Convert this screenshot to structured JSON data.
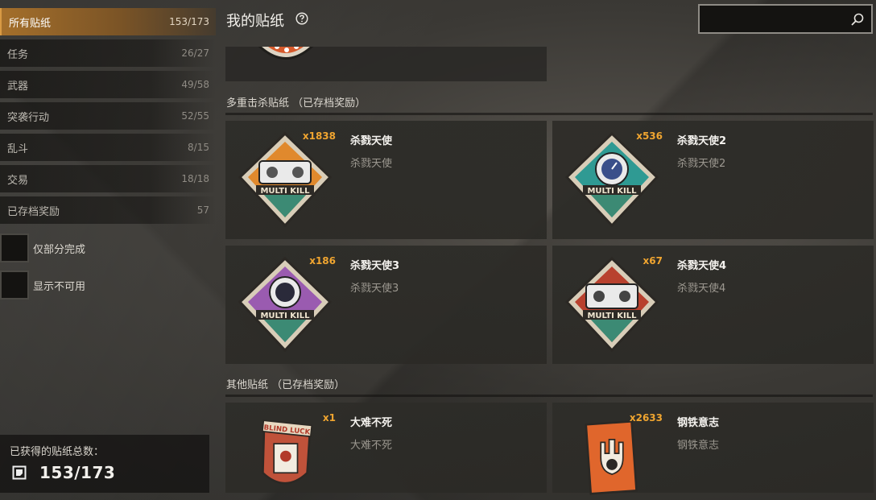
{
  "sidebar": {
    "categories": [
      {
        "label": "所有贴纸",
        "count": "153/173"
      },
      {
        "label": "任务",
        "count": "26/27"
      },
      {
        "label": "武器",
        "count": "49/58"
      },
      {
        "label": "突袭行动",
        "count": "52/55"
      },
      {
        "label": "乱斗",
        "count": "8/15"
      },
      {
        "label": "交易",
        "count": "18/18"
      },
      {
        "label": "已存档奖励",
        "count": "57"
      }
    ],
    "filters": [
      {
        "label": "仅部分完成"
      },
      {
        "label": "显示不可用"
      }
    ],
    "total": {
      "label": "已获得的贴纸总数：",
      "value": "153/173"
    }
  },
  "header": {
    "title": "我的贴纸",
    "search_placeholder": ""
  },
  "sections": [
    {
      "title": "多重击杀贴纸 （已存档奖励）",
      "cards": [
        {
          "qty": "x1838",
          "name": "杀戮天使",
          "sub": "杀戮天使"
        },
        {
          "qty": "x536",
          "name": "杀戮天使2",
          "sub": "杀戮天使2"
        },
        {
          "qty": "x186",
          "name": "杀戮天使3",
          "sub": "杀戮天使3"
        },
        {
          "qty": "x67",
          "name": "杀戮天使4",
          "sub": "杀戮天使4"
        }
      ]
    },
    {
      "title": "其他贴纸 （已存档奖励）",
      "cards": [
        {
          "qty": "x1",
          "name": "大难不死",
          "sub": "大难不死"
        },
        {
          "qty": "x2633",
          "name": "钢铁意志",
          "sub": "钢铁意志"
        }
      ]
    }
  ],
  "colors": {
    "accent": "#f0a530",
    "active_tab": "#a46f2b"
  }
}
